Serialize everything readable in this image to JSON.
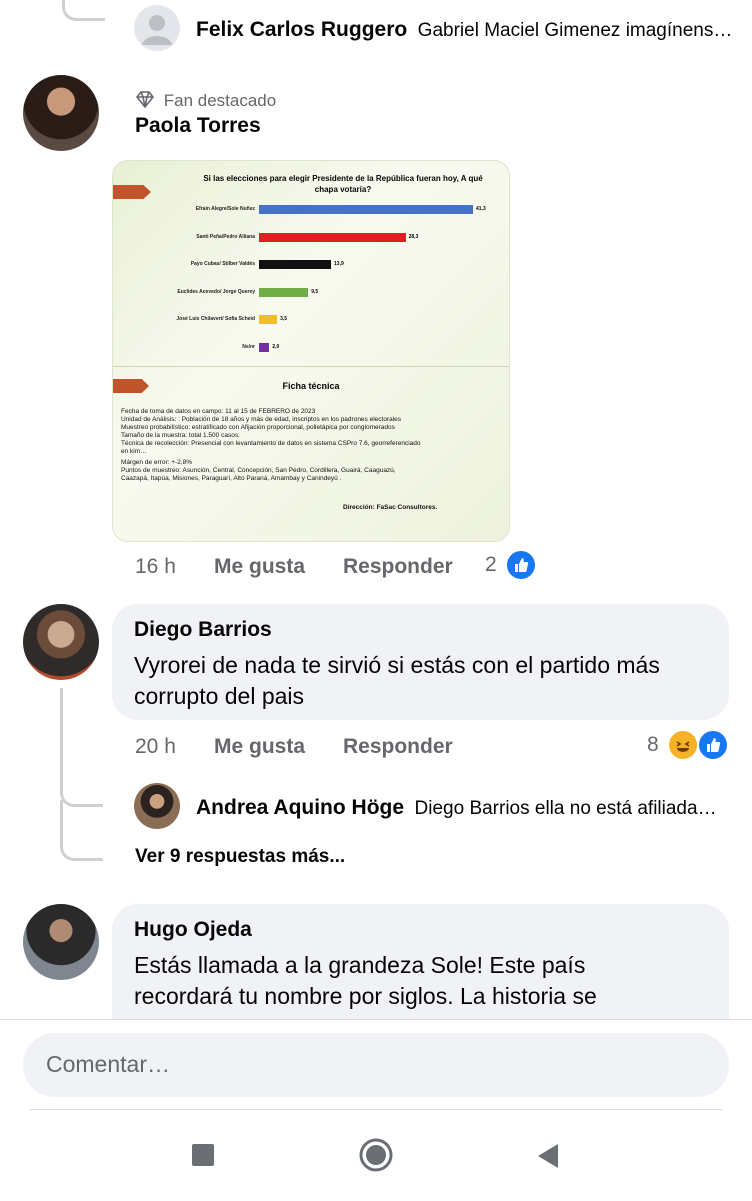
{
  "top_reply": {
    "name": "Felix Carlos Ruggero",
    "text": "Gabriel Maciel Gimenez imagínens…"
  },
  "comment1": {
    "badge": "Fan destacado",
    "name": "Paola Torres",
    "time": "16 h",
    "like_label": "Me gusta",
    "reply_label": "Responder",
    "reaction_count": "2",
    "image": {
      "title": "Si las elecciones para elegir Presidente de la República fueran hoy, A qué chapa votaría?",
      "ficha_title": "Ficha técnica",
      "ficha_lines": [
        "Fecha de toma de datos en campo: 11 al 15 de FEBRERO de 2023",
        "Unidad de Análisis: : Población de 18 años y más de edad, inscriptos en los padrones electorales",
        "Muestreo probabilístico: estratificado con Afijación proporcional, polietápica por conglomerados",
        "Tamaño de la muestra: total 1.500 casos.",
        "Técnica de recolección: Presencial con levantamiento de datos en sistema CSPro 7.6, georreferenciado",
        "en kim…",
        "Márgen de error: +-2,8%",
        "Puntos de muestreo: Asunción, Central, Concepción, San Pedro, Cordillera, Guairá, Caaguazú,",
        "Caazapá, Itapúa, Misiones, Paraguarí, Alto Paraná, Amambay y Canindeyú ."
      ],
      "direccion": "Dirección: FaSac Consultores."
    }
  },
  "chart_data": {
    "type": "bar",
    "orientation": "horizontal",
    "title": "Si las elecciones para elegir Presidente de la República fueran hoy, A qué chapa votaría?",
    "categories": [
      "Efraín Alegre/Sole Nuñez",
      "Santi Peña/Pedro Alliana",
      "Payo Cubas/ Stilber Valdés",
      "Euclides Acevedo/ Jorge Querey",
      "José Luis Chilavert/ Sofía Scheid",
      "Ns/nr"
    ],
    "values": [
      41.3,
      28.3,
      13.9,
      9.5,
      3.5,
      2.0
    ],
    "value_labels": [
      "41,3",
      "28,3",
      "13,9",
      "9,5",
      "3,5",
      "2,0"
    ],
    "colors": [
      "#4472c4",
      "#e02020",
      "#111111",
      "#70ad47",
      "#f0c020",
      "#7030a0"
    ],
    "xlim": [
      0,
      41.3
    ]
  },
  "comment2": {
    "name": "Diego Barrios",
    "text": "Vyrorei de nada te sirvió si estás con el partido más corrupto del pais",
    "time": "20 h",
    "like_label": "Me gusta",
    "reply_label": "Responder",
    "reaction_count": "8",
    "reply": {
      "name": "Andrea Aquino Höge",
      "text": "Diego Barrios ella no está afiliada…"
    },
    "more_replies": "Ver 9 respuestas más..."
  },
  "comment3": {
    "name": "Hugo Ojeda",
    "text": "Estás llamada a la grandeza Sole! Este país recordará tu nombre por siglos. La historia se"
  },
  "composer": {
    "placeholder": "Comentar…"
  },
  "colors": {
    "like_blue": "#1877f2",
    "bubble": "#f0f2f5",
    "secondary_text": "#65676b"
  }
}
